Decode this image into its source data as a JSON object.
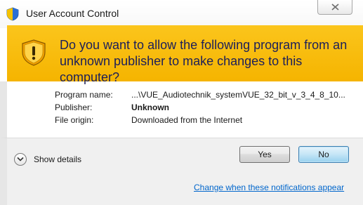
{
  "window": {
    "title": "User Account Control"
  },
  "banner": {
    "question": "Do you want to allow the following program from an unknown publisher to make changes to this computer?"
  },
  "details": {
    "program_name_label": "Program name:",
    "program_name_value": "...\\VUE_Audiotechnik_systemVUE_32_bit_v_3_4_8_10...",
    "publisher_label": "Publisher:",
    "publisher_value": "Unknown",
    "file_origin_label": "File origin:",
    "file_origin_value": "Downloaded from the Internet"
  },
  "footer": {
    "show_details_label": "Show details",
    "yes_label": "Yes",
    "no_label": "No",
    "notifications_link": "Change when these notifications appear"
  },
  "icons": {
    "title": "uac-shield-icon",
    "banner": "warning-shield-icon",
    "close": "close-icon",
    "show_details": "chevron-down-icon"
  },
  "colors": {
    "banner": "#f5b400",
    "banner_text": "#1c1f5a",
    "link": "#0066cc"
  }
}
